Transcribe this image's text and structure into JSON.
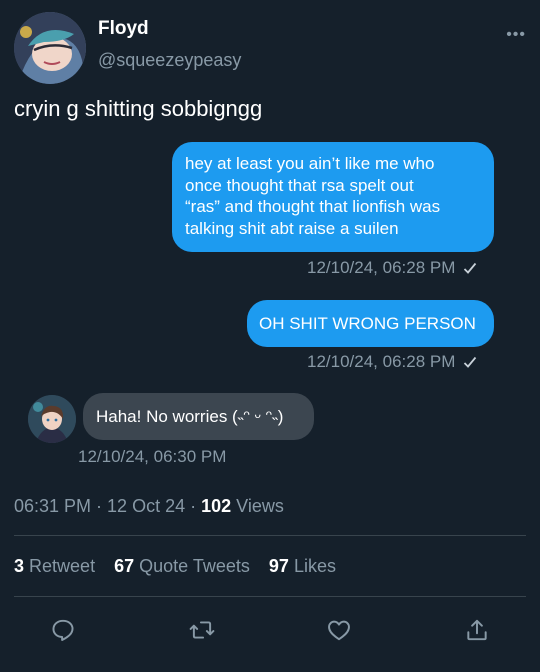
{
  "tweet": {
    "author_name": "Floyd",
    "author_handle": "@squeezeypeasy",
    "more_label": "•••",
    "text": "cryin g shitting sobbigngg"
  },
  "messages": [
    {
      "text": "hey at least you ain’t like me who\nonce thought that rsa spelt out\n“ras” and thought that lionfish was\ntalking shit abt raise a suilen",
      "timestamp": "12/10/24, 06:28 PM"
    },
    {
      "text": "OH SHIT WRONG PERSON",
      "timestamp": "12/10/24, 06:28 PM"
    },
    {
      "text": "Haha! No worries (˵ᵔ ᵕ ᵔ˵)",
      "timestamp": "12/10/24, 06:30 PM"
    }
  ],
  "meta": {
    "time": "06:31 PM",
    "date": "12 Oct 24",
    "views_count": "102",
    "views_label": "Views"
  },
  "stats": {
    "retweets_count": "3",
    "retweets_label": "Retweet",
    "quotes_count": "67",
    "quotes_label": "Quote Tweets",
    "likes_count": "97",
    "likes_label": "Likes"
  },
  "icons": [
    "reply-icon",
    "retweet-icon",
    "like-icon",
    "share-icon",
    "check-icon",
    "more-icon"
  ],
  "colors": {
    "background": "#15202b",
    "sent_bubble": "#1d9bf0",
    "received_bubble": "#3c4650",
    "secondary_text": "#8899a6"
  }
}
